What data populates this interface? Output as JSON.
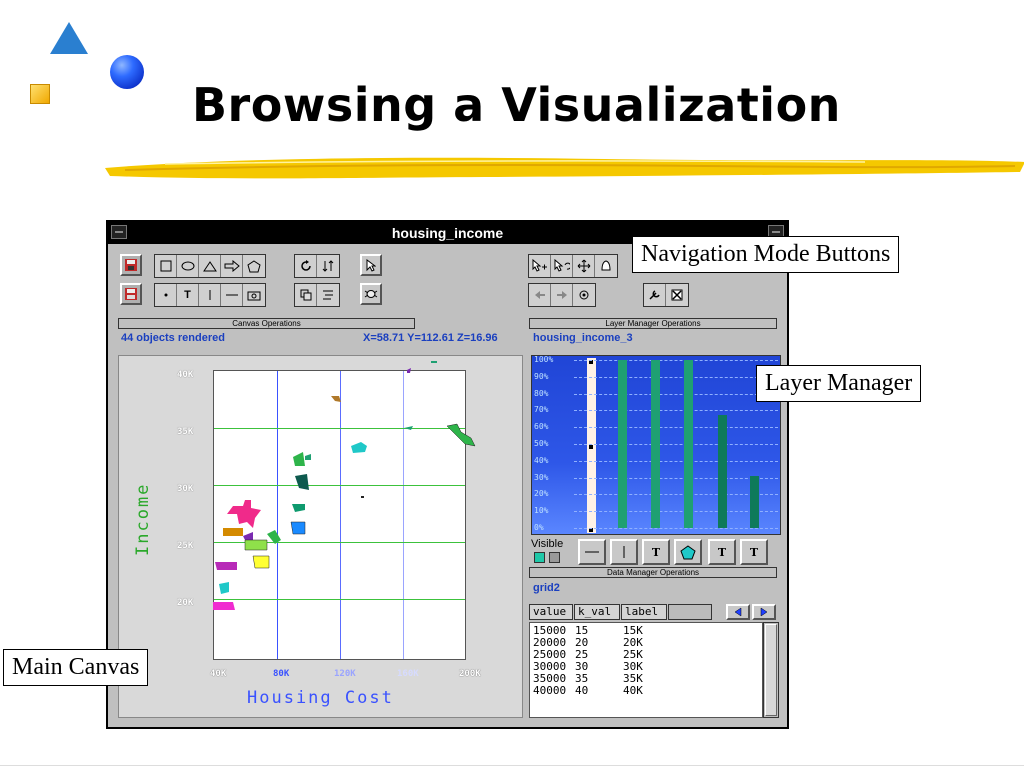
{
  "slide": {
    "title": "Browsing a Visualization"
  },
  "window": {
    "title": "housing_income",
    "canvas_ops_label": "Canvas Operations",
    "layer_ops_label": "Layer Manager Operations",
    "data_ops_label": "Data Manager Operations",
    "status_objects": "44 objects rendered",
    "status_coords": "X=58.71 Y=112.61 Z=16.96",
    "layer_name": "housing_income_3",
    "visible_label": "Visible",
    "data_table_name": "grid2"
  },
  "canvas": {
    "xlabel": "Housing Cost",
    "ylabel": "Income",
    "x_ticks": [
      "40K",
      "80K",
      "120K",
      "160K",
      "200K"
    ],
    "y_ticks": [
      "40K",
      "35K",
      "30K",
      "25K",
      "20K"
    ]
  },
  "layer_manager": {
    "percent_labels": [
      "100%",
      "90%",
      "80%",
      "70%",
      "60%",
      "50%",
      "40%",
      "30%",
      "20%",
      "10%",
      "0%"
    ],
    "bar_levels": [
      1.0,
      1.0,
      1.0,
      0.67,
      0.31
    ]
  },
  "data_manager": {
    "columns": [
      "value",
      "k_val",
      "label"
    ],
    "rows": [
      [
        "15000",
        "15",
        "15K"
      ],
      [
        "20000",
        "20",
        "20K"
      ],
      [
        "25000",
        "25",
        "25K"
      ],
      [
        "30000",
        "30",
        "30K"
      ],
      [
        "35000",
        "35",
        "35K"
      ],
      [
        "40000",
        "40",
        "40K"
      ]
    ]
  },
  "toolbar": {
    "text_button": "T"
  },
  "callouts": {
    "navigation": "Navigation Mode Buttons",
    "layer_manager": "Layer Manager",
    "main_canvas": "Main Canvas"
  },
  "colors": {
    "accent_blue": "#1a3fbf",
    "grid_green": "#3cc23c",
    "bar_green": "#1fa072"
  }
}
